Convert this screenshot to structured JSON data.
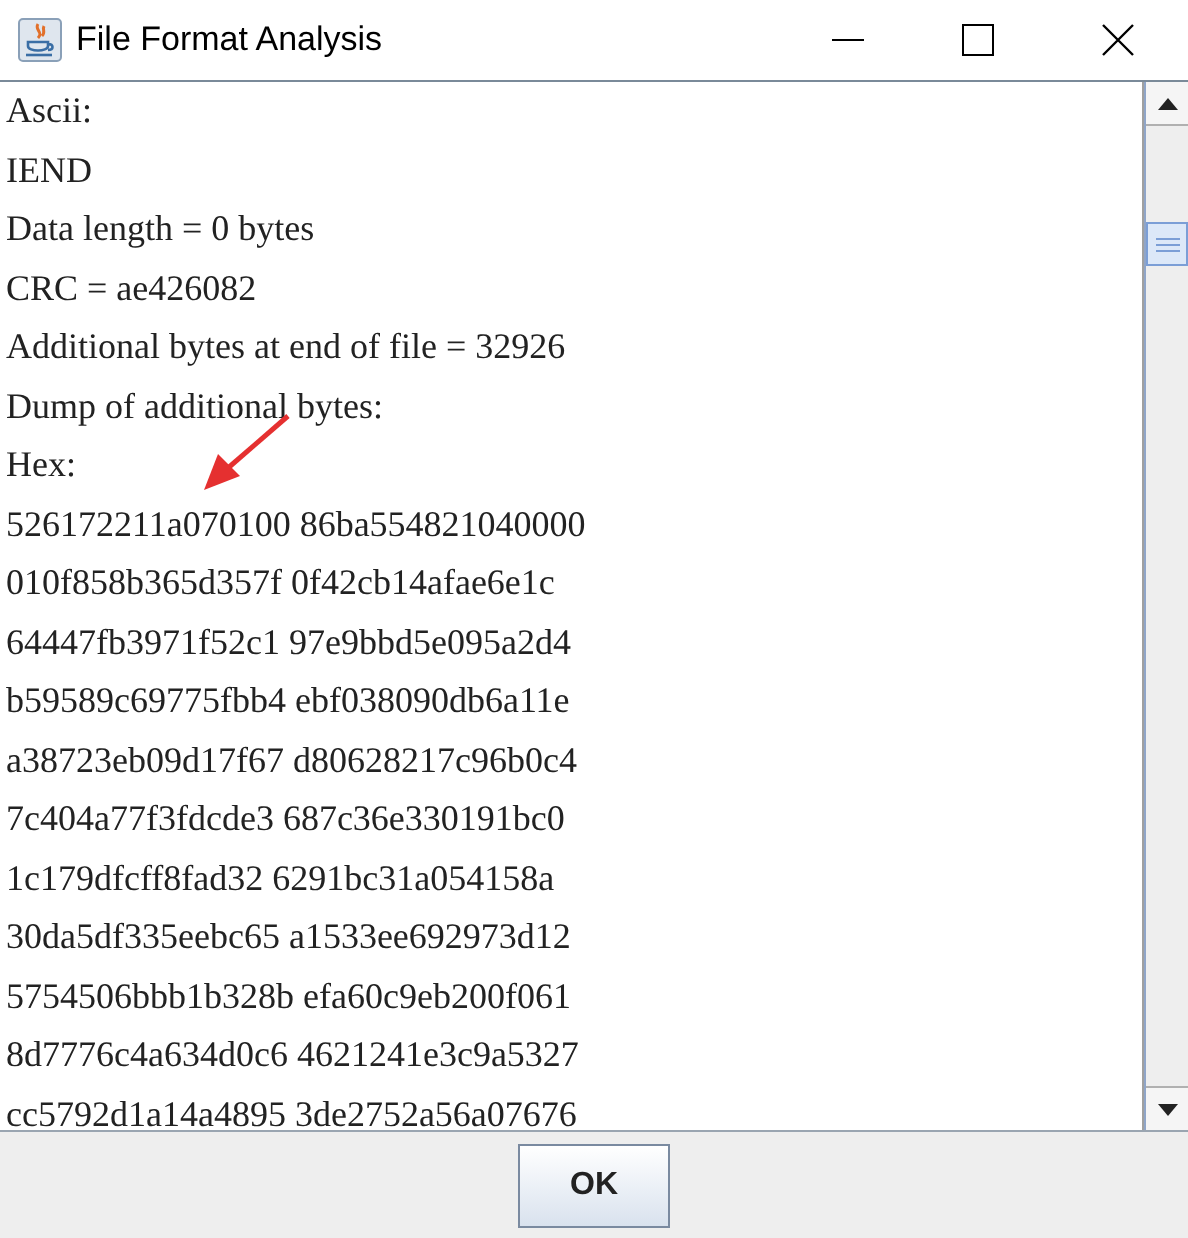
{
  "window": {
    "title": "File Format Analysis"
  },
  "text_lines": [
    "Ascii:",
    "IEND",
    "Data length = 0 bytes",
    "CRC = ae426082",
    "Additional bytes at end of file = 32926",
    "Dump of additional bytes:",
    "Hex:",
    "526172211a070100 86ba554821040000",
    "010f858b365d357f 0f42cb14afae6e1c",
    "64447fb3971f52c1 97e9bbd5e095a2d4",
    "b59589c69775fbb4 ebf038090db6a11e",
    "a38723eb09d17f67 d80628217c96b0c4",
    "7c404a77f3fdcde3 687c36e330191bc0",
    "1c179dfcff8fad32 6291bc31a054158a",
    "30da5df335eebc65 a1533ee692973d12",
    "5754506bbb1b328b efa60c9eb200f061",
    "8d7776c4a634d0c6 4621241e3c9a5327",
    "cc5792d1a14a4895 3de2752a56a07676"
  ],
  "buttons": [
    "OK"
  ]
}
